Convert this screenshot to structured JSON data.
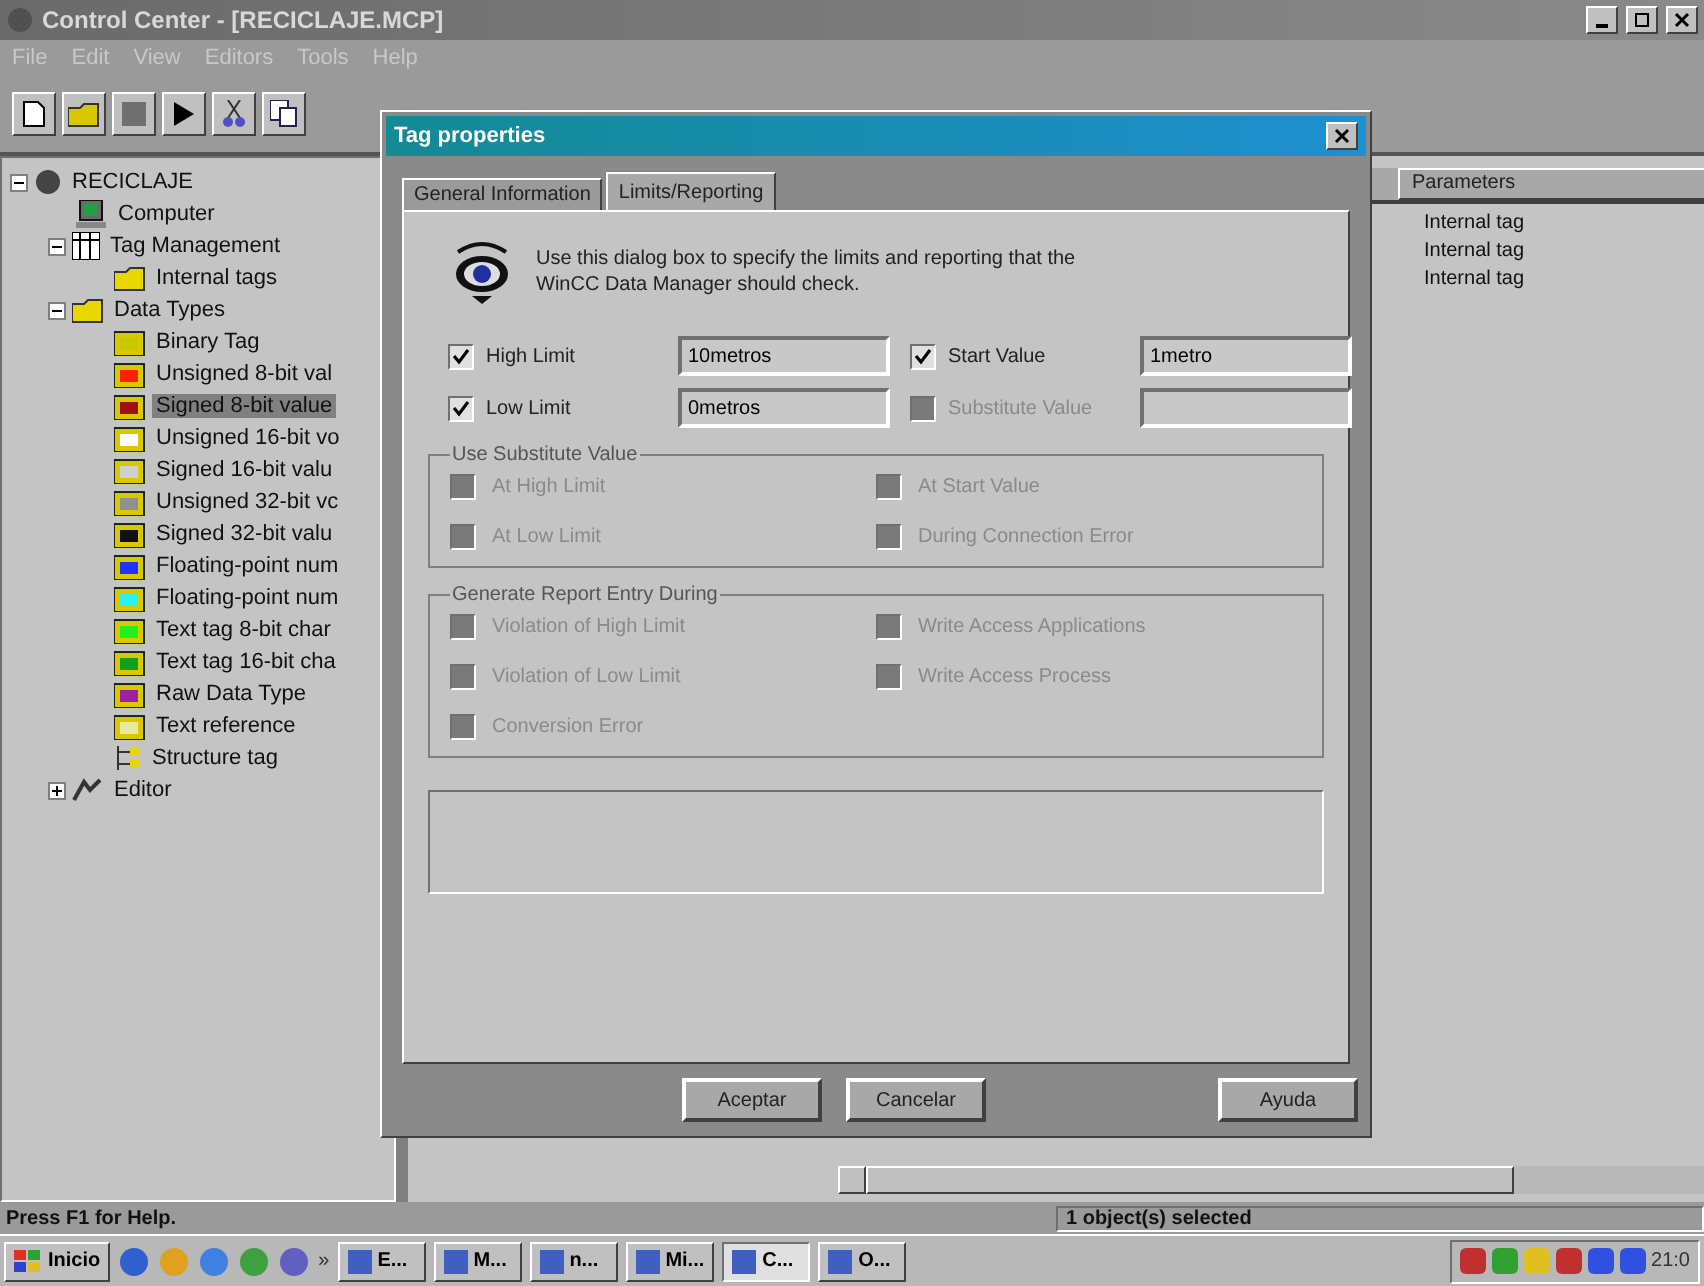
{
  "window": {
    "title": "Control Center - [RECICLAJE.MCP]"
  },
  "menu": [
    "File",
    "Edit",
    "View",
    "Editors",
    "Tools",
    "Help"
  ],
  "tree": [
    {
      "label": "RECICLAJE",
      "kind": "project",
      "expanded": true,
      "selected": false,
      "children": [
        {
          "label": "Computer",
          "kind": "computer",
          "selected": false
        },
        {
          "label": "Tag Management",
          "kind": "tags",
          "expanded": true,
          "selected": false,
          "children": [
            {
              "label": "Internal tags",
              "kind": "folder",
              "selected": false
            }
          ]
        },
        {
          "label": "Data Types",
          "kind": "folder",
          "expanded": true,
          "selected": false,
          "children": [
            {
              "label": "Binary Tag",
              "kind": "type",
              "color": "#c8c800",
              "selected": false
            },
            {
              "label": "Unsigned 8-bit val",
              "kind": "type",
              "color": "#ff2000",
              "selected": false
            },
            {
              "label": "Signed 8-bit value",
              "kind": "type",
              "color": "#a01010",
              "selected": true
            },
            {
              "label": "Unsigned 16-bit vo",
              "kind": "type",
              "color": "#ffffff",
              "selected": false
            },
            {
              "label": "Signed 16-bit valu",
              "kind": "type",
              "color": "#d0d0d0",
              "selected": false
            },
            {
              "label": "Unsigned 32-bit vc",
              "kind": "type",
              "color": "#909090",
              "selected": false
            },
            {
              "label": "Signed 32-bit valu",
              "kind": "type",
              "color": "#101010",
              "selected": false
            },
            {
              "label": "Floating-point num",
              "kind": "type",
              "color": "#2030ff",
              "selected": false
            },
            {
              "label": "Floating-point num",
              "kind": "type",
              "color": "#30f0f0",
              "selected": false
            },
            {
              "label": "Text tag 8-bit char",
              "kind": "type",
              "color": "#20f020",
              "selected": false
            },
            {
              "label": "Text tag 16-bit cha",
              "kind": "type",
              "color": "#10a020",
              "selected": false
            },
            {
              "label": "Raw Data Type",
              "kind": "type",
              "color": "#a020a0",
              "selected": false
            },
            {
              "label": "Text reference",
              "kind": "type",
              "color": "#e8e8a0",
              "selected": false
            },
            {
              "label": "Structure tag",
              "kind": "structure",
              "selected": false
            }
          ]
        },
        {
          "label": "Editor",
          "kind": "editor",
          "expanded": false,
          "selected": false
        }
      ]
    }
  ],
  "list": {
    "columns": [
      "Parameters"
    ],
    "rows": [
      [
        "Internal tag"
      ],
      [
        "Internal tag"
      ],
      [
        "Internal tag"
      ]
    ]
  },
  "status_bar": {
    "help": "Press F1 for Help.",
    "selection": "1 object(s) selected"
  },
  "dialog": {
    "title": "Tag properties",
    "tabs": [
      {
        "label": "General Information",
        "selected": false
      },
      {
        "label": "Limits/Reporting",
        "selected": true
      }
    ],
    "description": "Use this dialog box to specify the limits and reporting that the WinCC Data Manager should check.",
    "limits": [
      {
        "label": "High Limit",
        "checked": true,
        "disabled": false,
        "value": "10metros"
      },
      {
        "label": "Start Value",
        "checked": true,
        "disabled": false,
        "value": "1metro"
      },
      {
        "label": "Low Limit",
        "checked": true,
        "disabled": false,
        "value": "0metros"
      },
      {
        "label": "Substitute Value",
        "checked": false,
        "disabled": true
      }
    ],
    "groups": [
      {
        "title": "Use Substitute Value",
        "options": [
          {
            "label": "At High Limit",
            "checked": false,
            "disabled": true
          },
          {
            "label": "At Start Value",
            "checked": false,
            "disabled": true
          },
          {
            "label": "At Low Limit",
            "checked": false,
            "disabled": true
          },
          {
            "label": "During Connection Error",
            "checked": false,
            "disabled": true
          }
        ]
      },
      {
        "title": "Generate Report Entry During",
        "options": [
          {
            "label": "Violation of High Limit",
            "checked": false,
            "disabled": true
          },
          {
            "label": "Write Access Applications",
            "checked": false,
            "disabled": true
          },
          {
            "label": "Violation of Low Limit",
            "checked": false,
            "disabled": true
          },
          {
            "label": "Write Access Process",
            "checked": false,
            "disabled": true
          },
          {
            "label": "Conversion Error",
            "checked": false,
            "disabled": true
          }
        ]
      }
    ],
    "buttons": [
      {
        "label": "Aceptar"
      },
      {
        "label": "Cancelar"
      },
      {
        "label": "Ayuda"
      }
    ]
  },
  "taskbar": {
    "start": "Inicio",
    "chevron": "»",
    "tasks": [
      {
        "label": "E...",
        "selected": false
      },
      {
        "label": "M...",
        "selected": false
      },
      {
        "label": "n...",
        "selected": false
      },
      {
        "label": "Mi...",
        "selected": false
      },
      {
        "label": "C...",
        "selected": true
      },
      {
        "label": "O...",
        "selected": false
      }
    ],
    "clock": "21:0"
  }
}
